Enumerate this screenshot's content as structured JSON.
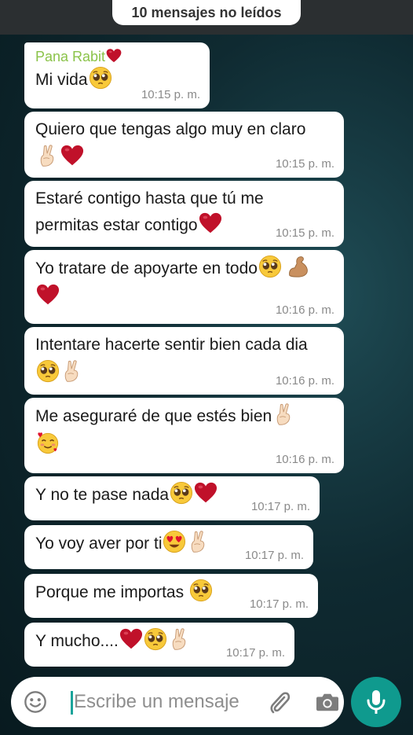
{
  "banner": {
    "unread": "10 mensajes no leídos"
  },
  "messages": [
    {
      "sender": "Pana Rabit",
      "line1": "Mi vida",
      "time": "10:15 p. m."
    },
    {
      "line1": "Quiero que tengas algo muy en claro",
      "time": "10:15 p. m."
    },
    {
      "line1": "Estaré contigo hasta que tú me",
      "line2": "permitas estar contigo",
      "time": "10:15 p. m."
    },
    {
      "line1": "Yo tratare de apoyarte en todo",
      "time": "10:16 p. m."
    },
    {
      "line1": "Intentare hacerte sentir bien cada dia",
      "time": "10:16 p. m."
    },
    {
      "line1": "Me aseguraré de que estés bien",
      "time": "10:16 p. m."
    },
    {
      "line1": "Y no te pase nada",
      "time": "10:17 p. m."
    },
    {
      "line1": "Yo voy aver por ti",
      "time": "10:17 p. m."
    },
    {
      "line1": "Porque me importas ",
      "time": "10:17 p. m."
    },
    {
      "line1": "Y mucho....",
      "time": "10:17 p. m."
    }
  ],
  "composer": {
    "placeholder": "Escribe un mensaje"
  },
  "icons": {
    "emoji": "emoji-icon",
    "attach": "paperclip-icon",
    "camera": "camera-icon",
    "mic": "microphone-icon",
    "reactions": [
      "heart",
      "pleading-face",
      "crossed-fingers",
      "flexed-biceps",
      "smiling-face-with-hearts",
      "heart-eyes"
    ]
  },
  "colors": {
    "accent": "#0f9a8e",
    "sender": "#8bc34a",
    "bubble": "#ffffff",
    "heart": "#c0112a"
  }
}
